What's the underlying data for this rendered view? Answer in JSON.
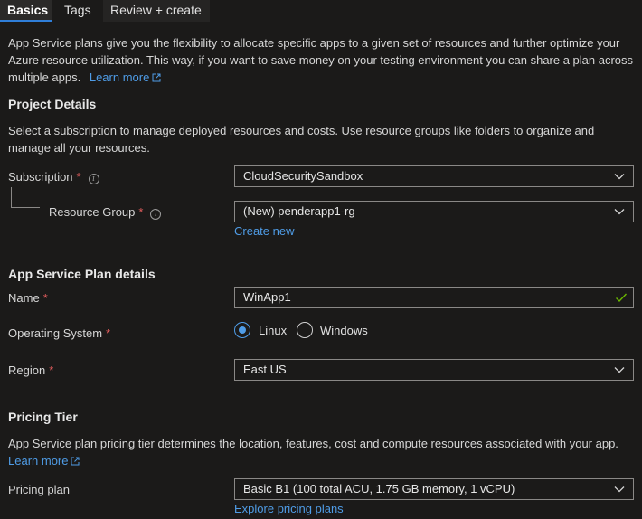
{
  "tabs": [
    {
      "label": "Basics"
    },
    {
      "label": "Tags"
    },
    {
      "label": "Review + create"
    }
  ],
  "intro": {
    "text": "App Service plans give you the flexibility to allocate specific apps to a given set of resources and further optimize your Azure resource utilization. This way, if you want to save money on your testing environment you can share a plan across multiple apps.",
    "learn_more": "Learn more"
  },
  "project": {
    "heading": "Project Details",
    "description": "Select a subscription to manage deployed resources and costs. Use resource groups like folders to organize and manage all your resources.",
    "subscription_label": "Subscription",
    "subscription_value": "CloudSecuritySandbox",
    "resource_group_label": "Resource Group",
    "resource_group_value": "(New) penderapp1-rg",
    "create_new": "Create new"
  },
  "plan": {
    "heading": "App Service Plan details",
    "name_label": "Name",
    "name_value": "WinApp1",
    "os_label": "Operating System",
    "os_options": [
      "Linux",
      "Windows"
    ],
    "os_selected": "Linux",
    "region_label": "Region",
    "region_value": "East US"
  },
  "pricing": {
    "heading": "Pricing Tier",
    "description": "App Service plan pricing tier determines the location, features, cost and compute resources associated with your app.",
    "learn_more": "Learn more",
    "plan_label": "Pricing plan",
    "plan_value": "Basic B1 (100 total ACU, 1.75 GB memory, 1 vCPU)",
    "explore": "Explore pricing plans"
  },
  "required_mark": "*",
  "colors": {
    "background": "#1b1a19",
    "link": "#4f9ce6",
    "required": "#e35d5d",
    "accent": "#2f7ed8",
    "valid": "#6bb700"
  }
}
